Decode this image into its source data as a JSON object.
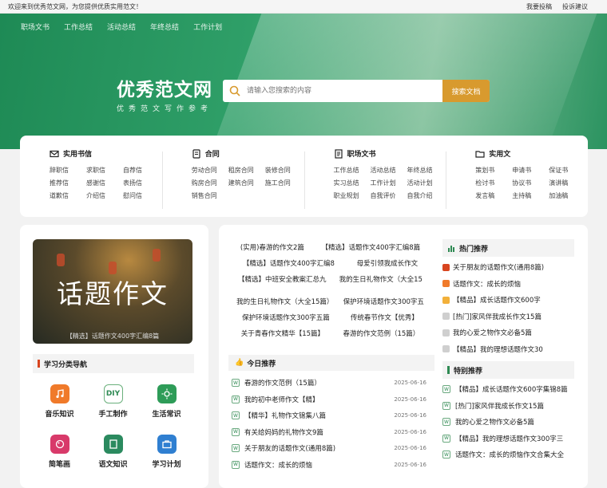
{
  "topbar": {
    "welcome": "欢迎来到优秀范文网，为您提供优质实用范文！",
    "submit": "我要投稿",
    "feedback": "投诉建议"
  },
  "nav": [
    "职场文书",
    "工作总结",
    "活动总结",
    "年终总结",
    "工作计划"
  ],
  "logo": {
    "main": "优秀范文网",
    "sub": "优秀范文写作参考"
  },
  "search": {
    "placeholder": "请输入您搜索的内容",
    "button": "搜索文档"
  },
  "categories": [
    {
      "title": "实用书信",
      "icon": "envelope-icon",
      "items": [
        "辞职信",
        "求职信",
        "自荐信",
        "推荐信",
        "感谢信",
        "表扬信",
        "道歉信",
        "介绍信",
        "慰问信"
      ]
    },
    {
      "title": "合同",
      "icon": "contract-icon",
      "items": [
        "劳动合同",
        "租房合同",
        "装修合同",
        "购房合同",
        "建筑合同",
        "施工合同",
        "销售合同"
      ]
    },
    {
      "title": "职场文书",
      "icon": "document-icon",
      "items": [
        "工作总结",
        "活动总结",
        "年终总结",
        "实习总结",
        "工作计划",
        "活动计划",
        "职业规划",
        "自我评价",
        "自我介绍"
      ]
    },
    {
      "title": "实用文",
      "icon": "folder-icon",
      "items": [
        "策划书",
        "申请书",
        "保证书",
        "检讨书",
        "协议书",
        "演讲稿",
        "发言稿",
        "主持稿",
        "加油稿"
      ]
    }
  ],
  "banner": {
    "title": "话题作文",
    "caption": "【精选】话题作文400字汇编8篇"
  },
  "study": {
    "title": "学习分类导航",
    "apps": [
      {
        "label": "音乐知识",
        "icon": "music-icon",
        "color": "#f07a2a"
      },
      {
        "label": "手工制作",
        "icon": "diy-icon",
        "color": "#ffffff"
      },
      {
        "label": "生活常识",
        "icon": "sun-icon",
        "color": "#2e9c58"
      },
      {
        "label": "简笔画",
        "icon": "palette-icon",
        "color": "#d83a6a"
      },
      {
        "label": "语文知识",
        "icon": "book-icon",
        "color": "#2b8a5f"
      },
      {
        "label": "学习计划",
        "icon": "briefcase-icon",
        "color": "#2f7fd1"
      }
    ]
  },
  "tags": [
    [
      "(实用)春游的作文2篇",
      "【精选】话题作文400字汇编8篇"
    ],
    [
      "【精选】话题作文400字汇编8",
      "母爱引领我成长作文"
    ],
    [
      "【精选】中班安全教案汇总九",
      "我的生日礼物作文（大全15"
    ],
    [
      "我的生日礼物作文（大全15篇）",
      "保护环境话题作文300字五"
    ],
    [
      "保护环境话题作文300字五篇",
      "传统春节作文【优秀】"
    ],
    [
      "关于青春作文精华【15篇】",
      "春游的作文范例（15篇）"
    ]
  ],
  "today": {
    "title": "今日推荐",
    "items": [
      {
        "title": "春游的作文范例（15篇）",
        "date": "2025-06-16"
      },
      {
        "title": "我的初中老师作文【精】",
        "date": "2025-06-16"
      },
      {
        "title": "【精华】礼物作文锦集八篇",
        "date": "2025-06-16"
      },
      {
        "title": "有关给妈妈的礼物作文9篇",
        "date": "2025-06-16"
      },
      {
        "title": "关于朋友的话题作文(通用8篇)",
        "date": "2025-06-16"
      },
      {
        "title": "话题作文：成长的烦恼",
        "date": "2025-06-16"
      }
    ]
  },
  "hot": {
    "title": "热门推荐",
    "items": [
      {
        "title": "关于朋友的话题作文(通用8篇)",
        "color": "#d8451f"
      },
      {
        "title": "话题作文：成长的烦恼",
        "color": "#f07a2a"
      },
      {
        "title": "【精品】成长话题作文600字",
        "color": "#f2b03a"
      },
      {
        "title": "[热门]家风伴我成长作文15篇",
        "color": "#cfcfcf"
      },
      {
        "title": "我的心爱之物作文必备5篇",
        "color": "#cfcfcf"
      },
      {
        "title": "【精品】我的理想话题作文30",
        "color": "#cfcfcf"
      }
    ]
  },
  "special": {
    "title": "特别推荐",
    "items": [
      "【精品】成长话题作文600字集锦8篇",
      "[热门]家风伴我成长作文15篇",
      "我的心爱之物作文必备5篇",
      "【精品】我的理想话题作文300字三",
      "话题作文：成长的烦恼作文合集大全"
    ]
  }
}
